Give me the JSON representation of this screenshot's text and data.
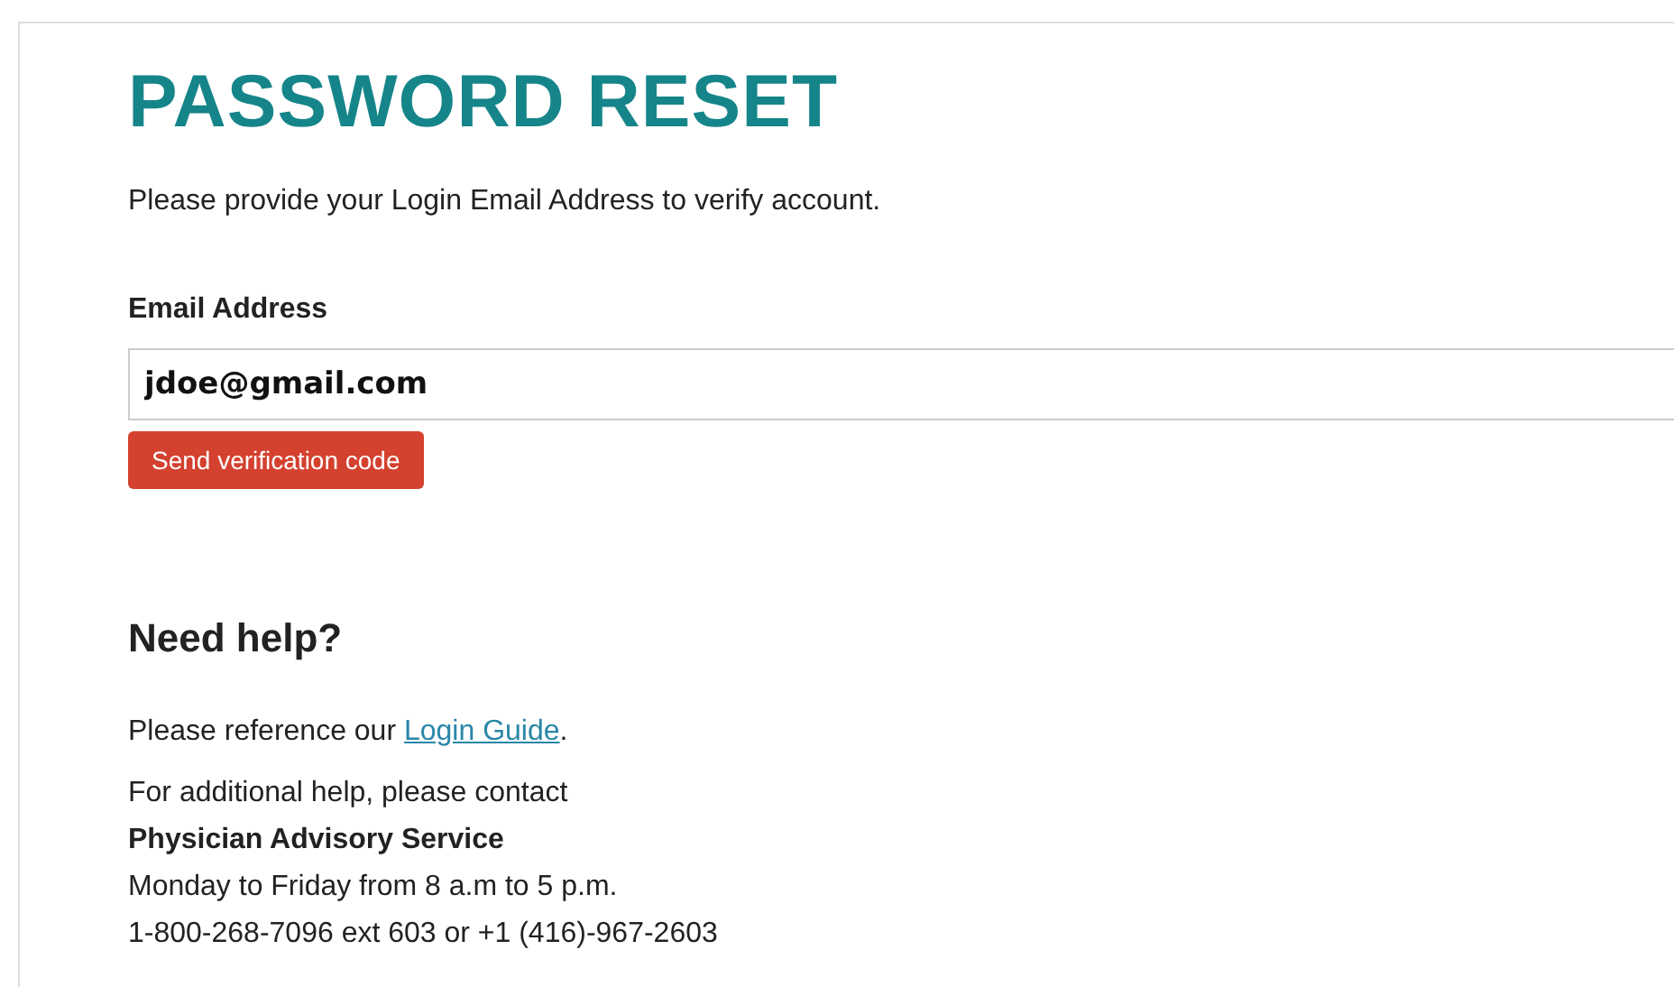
{
  "title": "PASSWORD RESET",
  "instructions": "Please provide your Login Email Address to verify account.",
  "email_field": {
    "label": "Email Address",
    "value": "jdoe@gmail.com"
  },
  "send_button": "Send verification code",
  "help": {
    "heading": "Need help?",
    "reference": {
      "before": "Please reference our ",
      "link": "Login Guide",
      "after": "."
    },
    "contact_lines": [
      {
        "text": "For additional help, please contact",
        "bold": false
      },
      {
        "text": "Physician Advisory Service",
        "bold": true
      },
      {
        "text": "Monday to Friday from 8 a.m to 5 p.m.",
        "bold": false
      },
      {
        "text": "1-800-268-7096 ext 603 or +1 (416)-967-2603",
        "bold": false
      }
    ]
  }
}
